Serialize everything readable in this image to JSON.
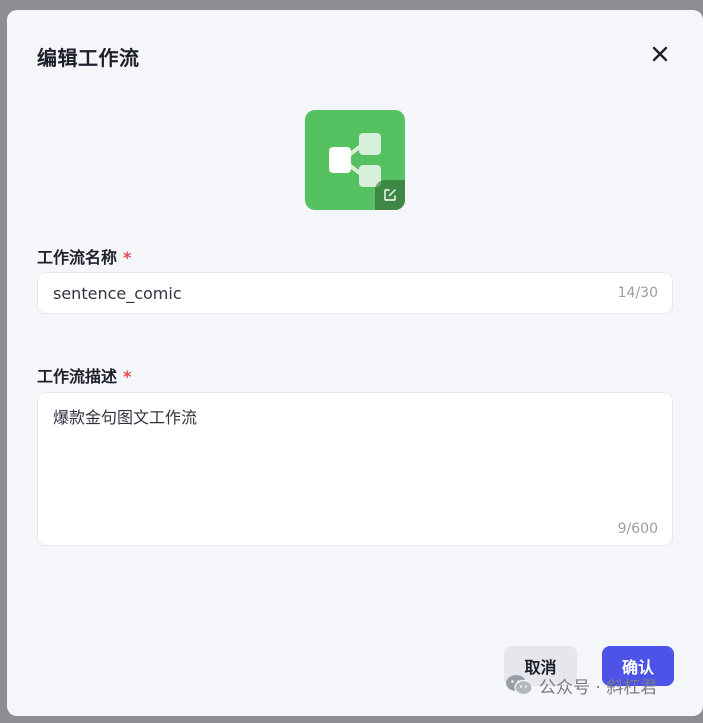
{
  "dialog": {
    "title": "编辑工作流",
    "close_icon": "close-icon",
    "app_icon": {
      "icon": "workflow-icon",
      "badge_icon": "edit-icon",
      "color": "#55c160"
    }
  },
  "form": {
    "name": {
      "label": "工作流名称",
      "required_mark": "*",
      "value": "sentence_comic",
      "counter": "14/30"
    },
    "description": {
      "label": "工作流描述",
      "required_mark": "*",
      "value": "爆款金句图文工作流",
      "counter": "9/600"
    }
  },
  "footer": {
    "cancel_label": "取消",
    "confirm_label": "确认",
    "confirm_color": "#4d53e8"
  },
  "watermark": {
    "icon": "wechat-icon",
    "text": "公众号 · 斜杠君"
  }
}
